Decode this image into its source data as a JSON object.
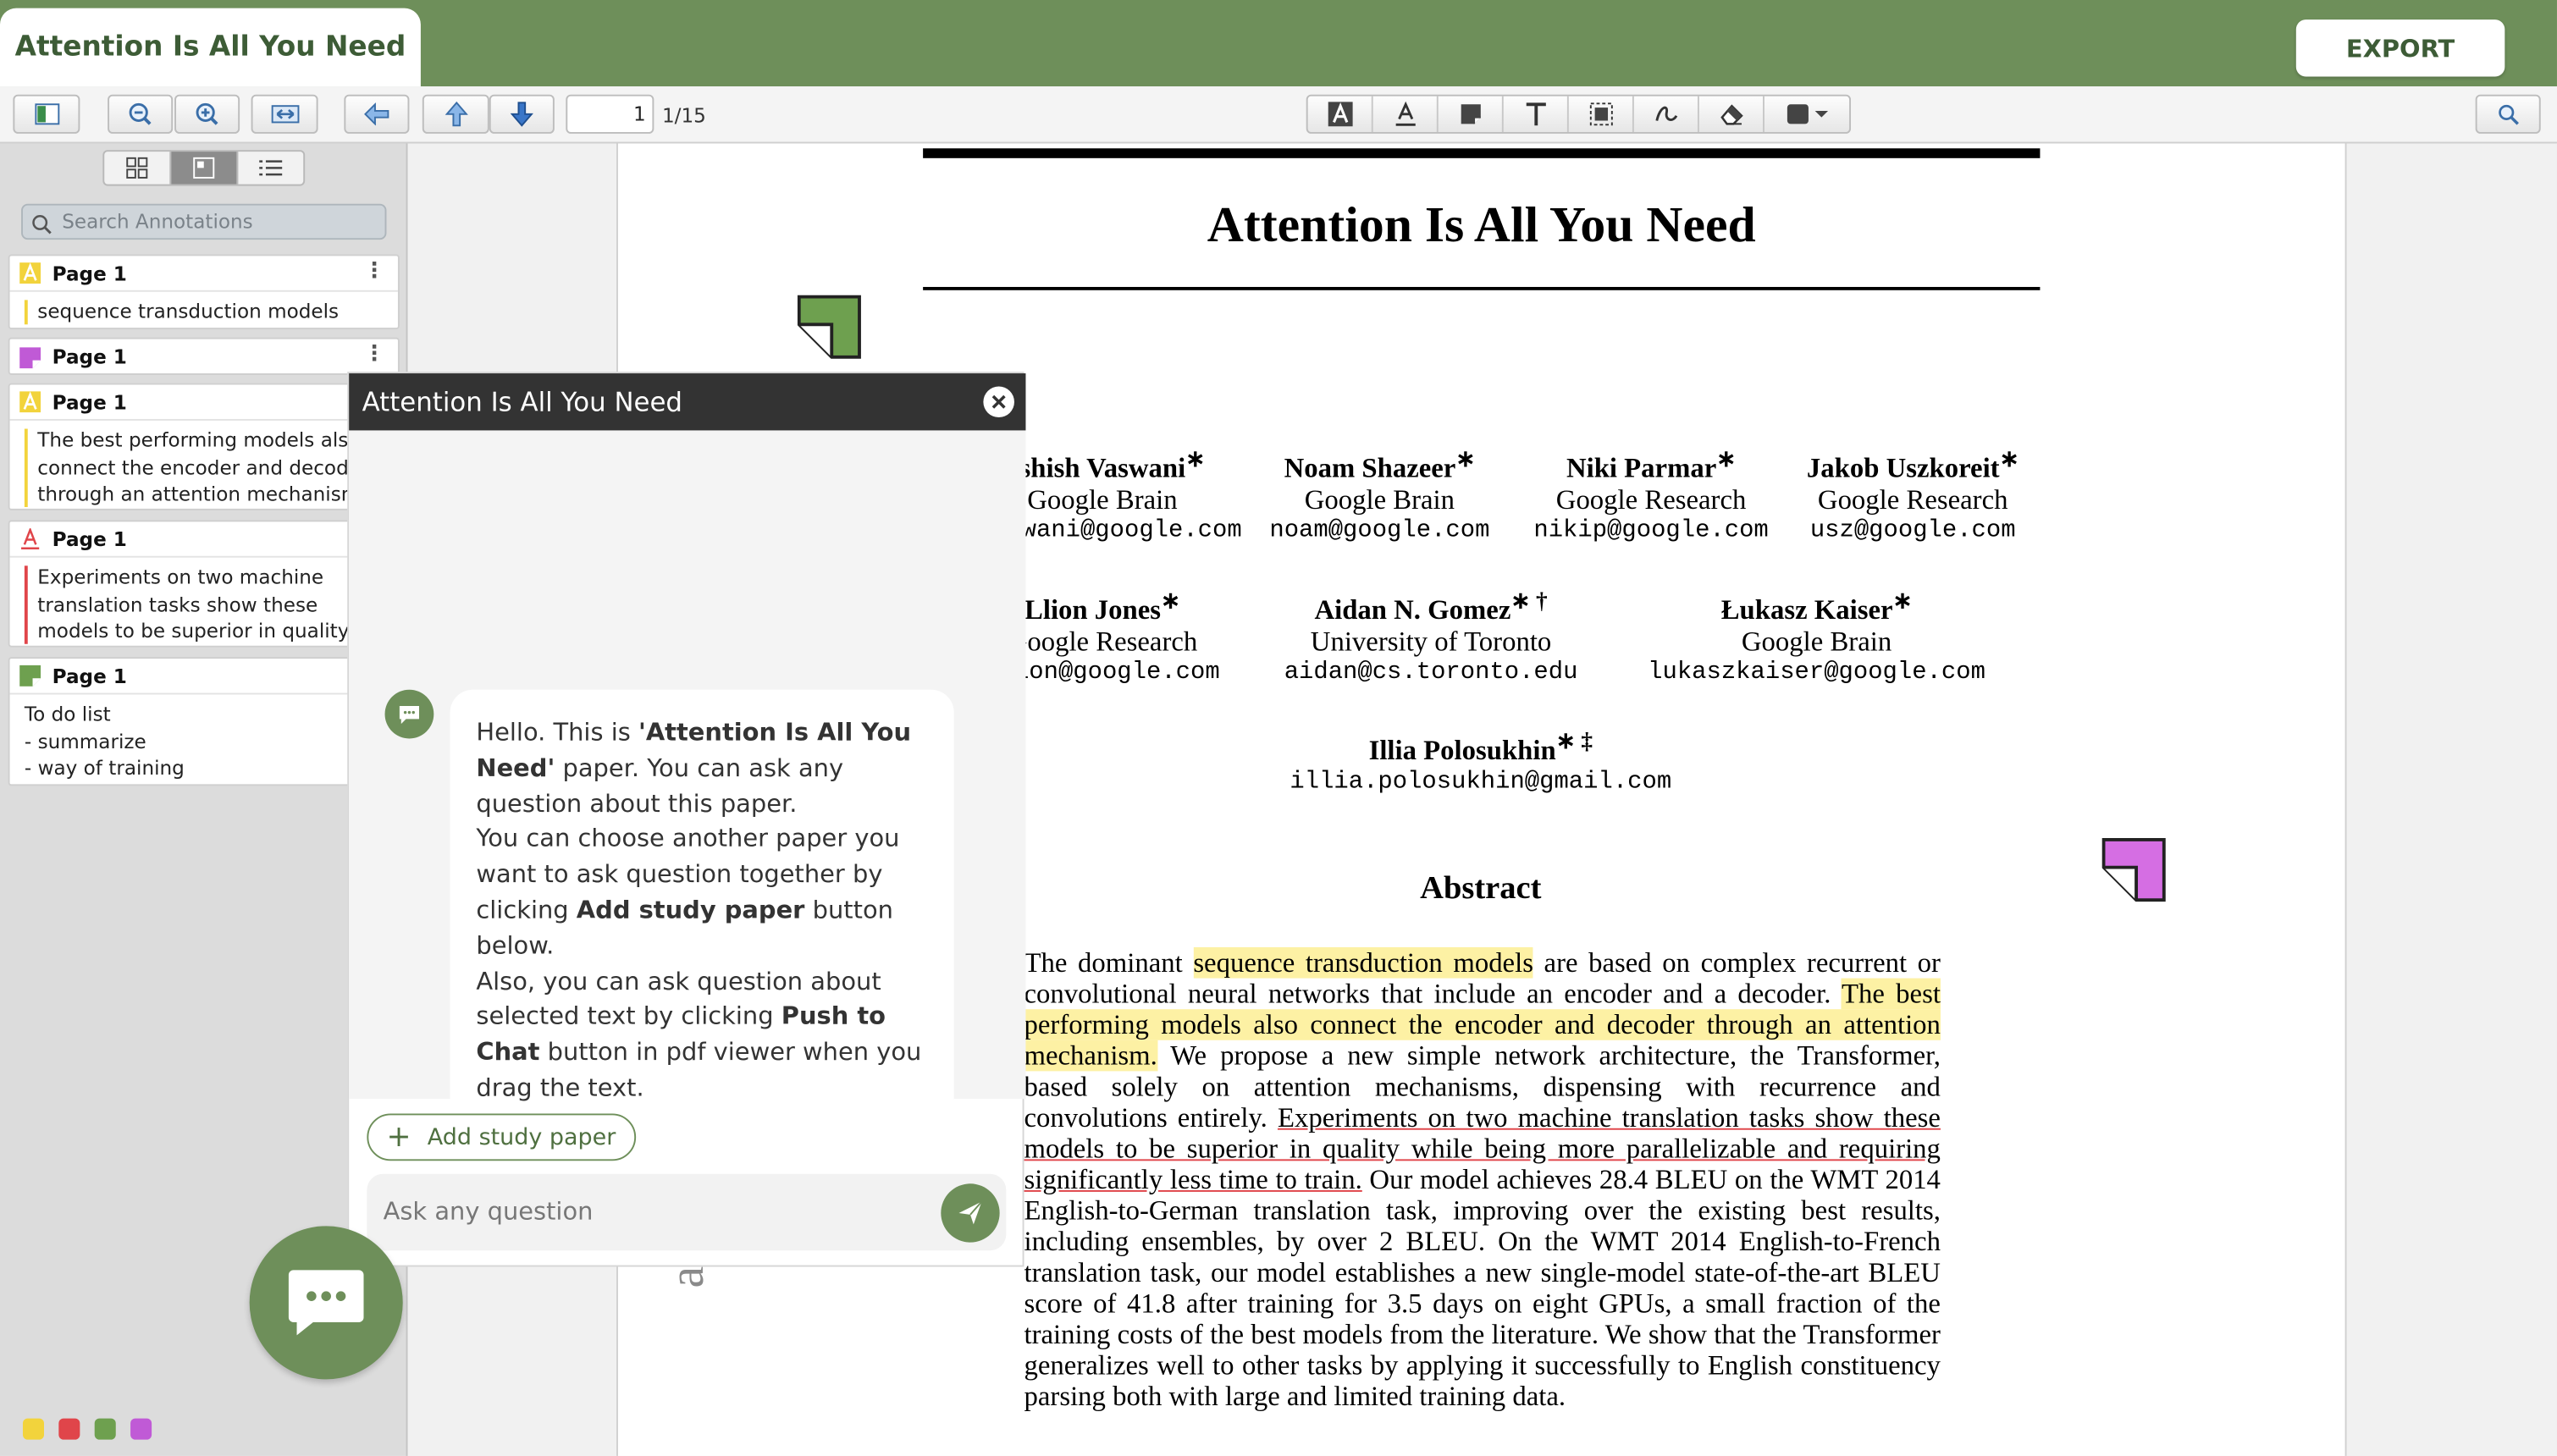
{
  "header": {
    "doc_tab": "Attention Is All You Need",
    "export_label": "EXPORT"
  },
  "toolbar": {
    "page_value": "1",
    "page_total": "1/15",
    "buttons": [
      "toggle-sidebar-icon",
      "zoom-out-icon",
      "zoom-in-icon",
      "fit-width-icon",
      "back-icon",
      "prev-page-icon",
      "next-page-icon"
    ],
    "annotation_tools": [
      "highlight-text-icon",
      "underline-text-icon",
      "note-icon",
      "free-text-icon",
      "area-select-icon",
      "ink-icon",
      "eraser-icon",
      "shape-dropdown-icon"
    ]
  },
  "sidebar": {
    "view_modes": [
      "thumbnails-icon",
      "document-outline-icon",
      "annotation-list-icon"
    ],
    "search_placeholder": "Search Annotations",
    "annotations": [
      {
        "page": "Page 1",
        "type": "highlight",
        "color": "#f2d33c",
        "text": "sequence transduction models"
      },
      {
        "page": "Page 1",
        "type": "note",
        "color": "#c05ad6",
        "text": ""
      },
      {
        "page": "Page 1",
        "type": "highlight",
        "color": "#f2d33c",
        "text": "The best performing models also\nconnect the encoder and decoder\nthrough an attention mechanism"
      },
      {
        "page": "Page 1",
        "type": "underline",
        "color": "#e0454a",
        "text": "Experiments on two machine\ntranslation tasks show these\nmodels to be superior in quality..."
      },
      {
        "page": "Page 1",
        "type": "note",
        "color": "#6ea04f",
        "text": "To do list\n- summarize\n- way of training"
      }
    ],
    "color_swatches": [
      "#f2d33c",
      "#e0454a",
      "#6ea04f",
      "#c05ad6"
    ]
  },
  "paper": {
    "title": "Attention Is All You Need",
    "authors": [
      {
        "name": "Ashish Vaswani",
        "mark": "∗",
        "affil": "Google Brain",
        "email": "avaswani@google.com"
      },
      {
        "name": "Noam Shazeer",
        "mark": "∗",
        "affil": "Google Brain",
        "email": "noam@google.com"
      },
      {
        "name": "Niki Parmar",
        "mark": "∗",
        "affil": "Google Research",
        "email": "nikip@google.com"
      },
      {
        "name": "Jakob Uszkoreit",
        "mark": "∗",
        "affil": "Google Research",
        "email": "usz@google.com"
      },
      {
        "name": "Llion Jones",
        "mark": "∗",
        "affil": "Google Research",
        "email": "llion@google.com"
      },
      {
        "name": "Aidan N. Gomez",
        "mark": "∗ †",
        "affil": "University of Toronto",
        "email": "aidan@cs.toronto.edu"
      },
      {
        "name": "Łukasz Kaiser",
        "mark": "∗",
        "affil": "Google Brain",
        "email": "lukaszkaiser@google.com"
      },
      {
        "name": "Illia Polosukhin",
        "mark": "∗ ‡",
        "affil": "",
        "email": "illia.polosukhin@gmail.com"
      }
    ],
    "abstract_heading": "Abstract",
    "abstract": {
      "p1": "The dominant ",
      "h1": "sequence transduction models",
      "p2": " are based on complex recurrent or convolutional neural networks that include an encoder and a decoder. ",
      "h2": "The best performing models also connect the encoder and decoder through an attention mechanism.",
      "p3": " We propose a new simple network architecture, the Transformer, based solely on attention mechanisms, dispensing with recurrence and convolutions entirely. ",
      "u1": "Experiments on two machine translation tasks show these models to be superior in quality while being more parallelizable and requiring significantly less time to train.",
      "p4": " Our model achieves 28.4 BLEU on the WMT 2014 English-to-German translation task, improving over the existing best results, including ensembles, by over 2 BLEU. On the WMT 2014 English-to-French translation task, our model establishes a new single-model state-of-the-art BLEU score of 41.8 after training for 3.5 days on eight GPUs, a small fraction of the training costs of the best models from the literature. We show that the Transformer generalizes well to other tasks by applying it successfully to English constituency parsing both with large and limited training data."
    },
    "margin_text": "arX",
    "note_colors": [
      "#6ea04f",
      "#d56ee3"
    ]
  },
  "chat": {
    "title": "Attention Is All You Need",
    "message": {
      "t1": "Hello. This is ",
      "b1": "'Attention Is All You Need'",
      "t2": " paper. You can ask any question about this paper.",
      "t3": "You can choose another paper you want to ask question together by clicking ",
      "b2": "Add study paper",
      "t4": " button below.",
      "t5": "Also, you can ask question about selected text by clicking ",
      "b3": "Push to Chat",
      "t6": " button in pdf viewer when you drag the text."
    },
    "add_paper_label": "Add study paper",
    "input_placeholder": "Ask any question"
  },
  "colors": {
    "brand_green": "#6e8f5a",
    "chat_header": "#333333",
    "highlight": "#fdf1a4",
    "underline": "#e0454a"
  }
}
